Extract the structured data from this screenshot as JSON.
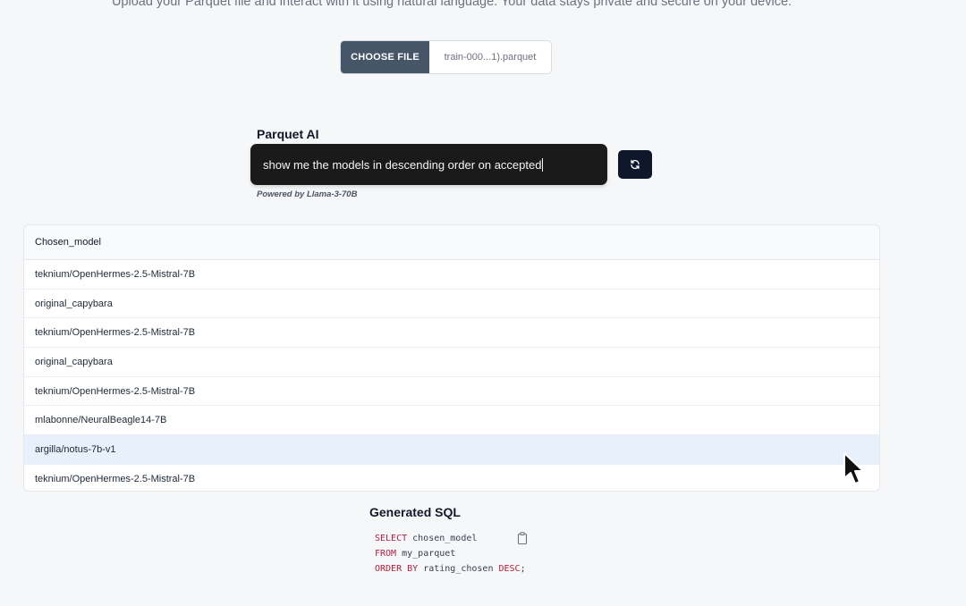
{
  "header": {
    "subtitle": "Upload your Parquet file and interact with it using natural language. Your data stays private and secure on your device."
  },
  "file_picker": {
    "button_label": "CHOOSE FILE",
    "file_name": "train-000...1).parquet"
  },
  "ai": {
    "title": "Parquet AI",
    "prompt_value": "show me the models in descending order on accepted",
    "powered_by": "Powered by Llama-3-70B",
    "refresh_icon": "refresh-icon"
  },
  "table": {
    "column_header": "Chosen_model",
    "rows": [
      "teknium/OpenHermes-2.5-Mistral-7B",
      "original_capybara",
      "teknium/OpenHermes-2.5-Mistral-7B",
      "original_capybara",
      "teknium/OpenHermes-2.5-Mistral-7B",
      "mlabonne/NeuralBeagle14-7B",
      "argilla/notus-7b-v1",
      "teknium/OpenHermes-2.5-Mistral-7B"
    ],
    "highlighted_row": 6
  },
  "sql": {
    "title": "Generated SQL",
    "line1_kw": "SELECT",
    "line1_rest": " chosen_model",
    "line2_kw": "FROM",
    "line2_rest": " my_parquet",
    "line3_kw": "ORDER BY",
    "line3_rest": " rating_chosen ",
    "line3_kw2": "DESC",
    "line3_end": ";",
    "copy_icon": "clipboard-icon"
  },
  "colors": {
    "choose_button": "#475569",
    "prompt_bg": "#1a1a1a",
    "refresh_button": "#0f172a",
    "highlight_row": "#e8f0fb",
    "sql_keyword": "#b91c3c"
  }
}
